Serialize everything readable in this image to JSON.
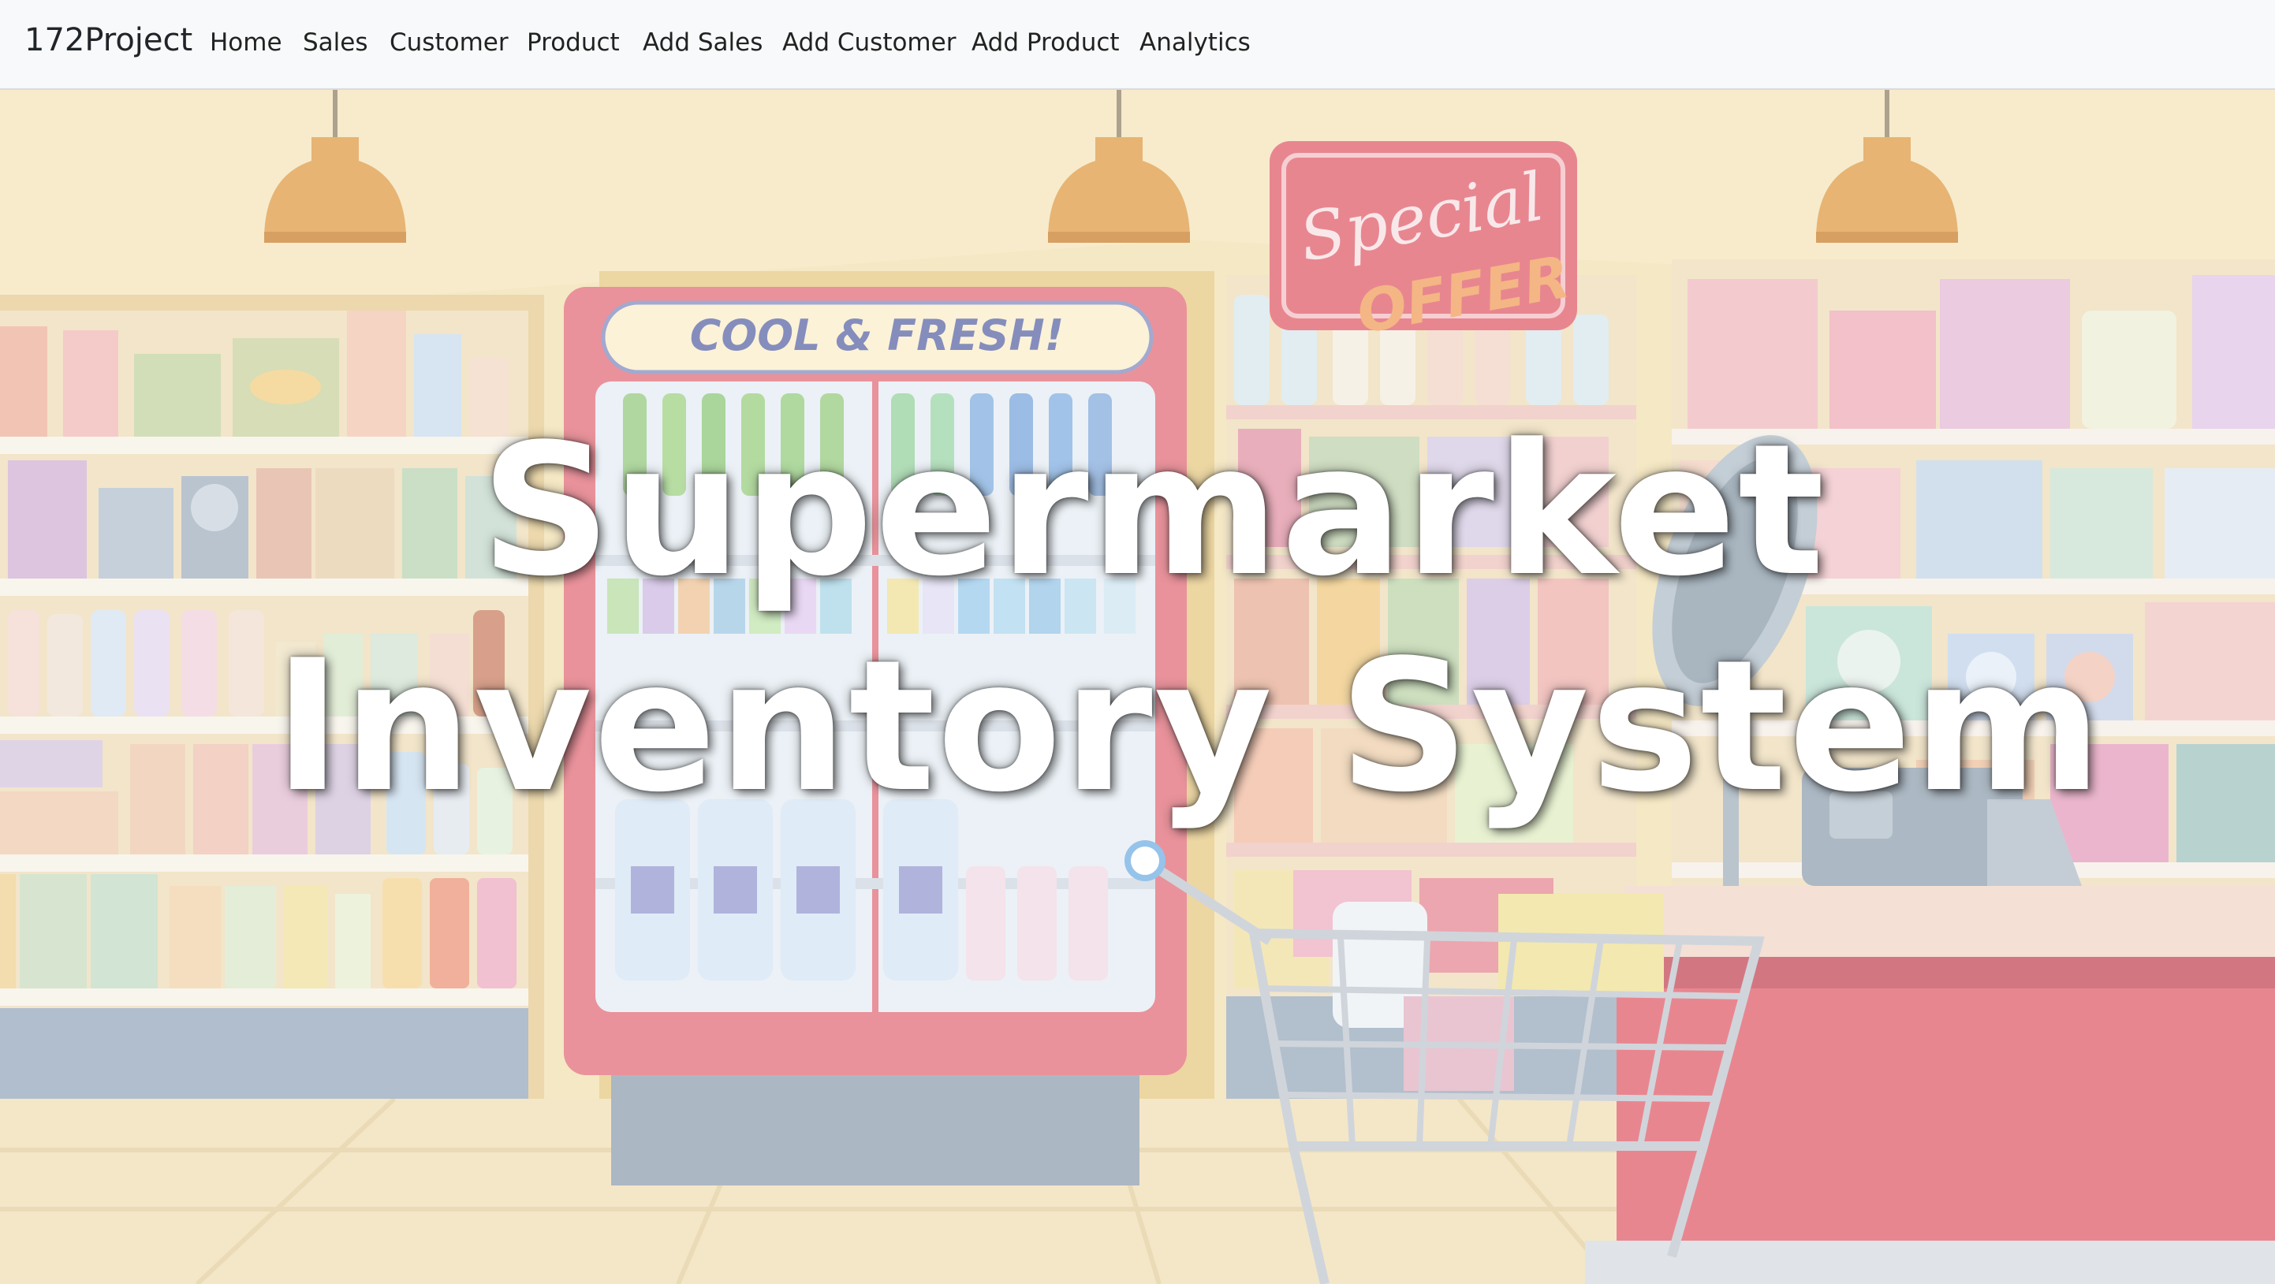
{
  "navbar": {
    "brand": "172Project",
    "links": [
      "Home",
      "Sales",
      "Customer",
      "Product",
      "Add Sales",
      "Add Customer",
      "Add Product",
      "Analytics"
    ]
  },
  "hero": {
    "title_line1": "Supermarket",
    "title_line2": "Inventory System",
    "fridge_sign": "COOL & FRESH!",
    "special_sign_line1": "Special",
    "special_sign_line2": "OFFER"
  },
  "colors": {
    "navbar_bg": "#f8f9fa",
    "wall": "#f3e3b8",
    "floor": "#f2e2bc",
    "fridge_frame": "#e47a85",
    "counter": "#e36c78"
  }
}
